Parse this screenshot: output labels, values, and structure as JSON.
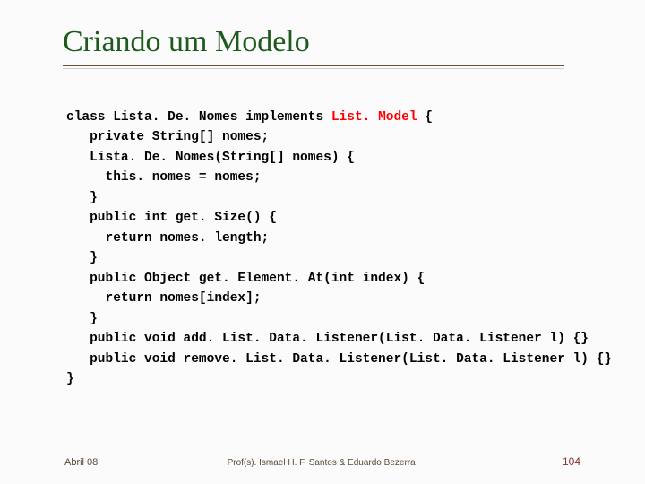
{
  "title": "Criando um Modelo",
  "code": {
    "l01a": "class Lista. De. Nomes implements ",
    "l01b": "List. Model",
    "l01c": " {",
    "l02": "   private String[] nomes;",
    "l03": "   Lista. De. Nomes(String[] nomes) {",
    "l04": "     this. nomes = nomes;",
    "l05": "   }",
    "l06": "   public int get. Size() {",
    "l07": "     return nomes. length;",
    "l08": "   }",
    "l09": "   public Object get. Element. At(int index) {",
    "l10": "     return nomes[index];",
    "l11": "   }",
    "l12": "   public void add. List. Data. Listener(List. Data. Listener l) {}",
    "l13": "   public void remove. List. Data. Listener(List. Data. Listener l) {}",
    "l14": "}"
  },
  "footer": {
    "date": "Abril 08",
    "credits": "Prof(s). Ismael H. F. Santos & Eduardo Bezerra",
    "page": "104"
  }
}
